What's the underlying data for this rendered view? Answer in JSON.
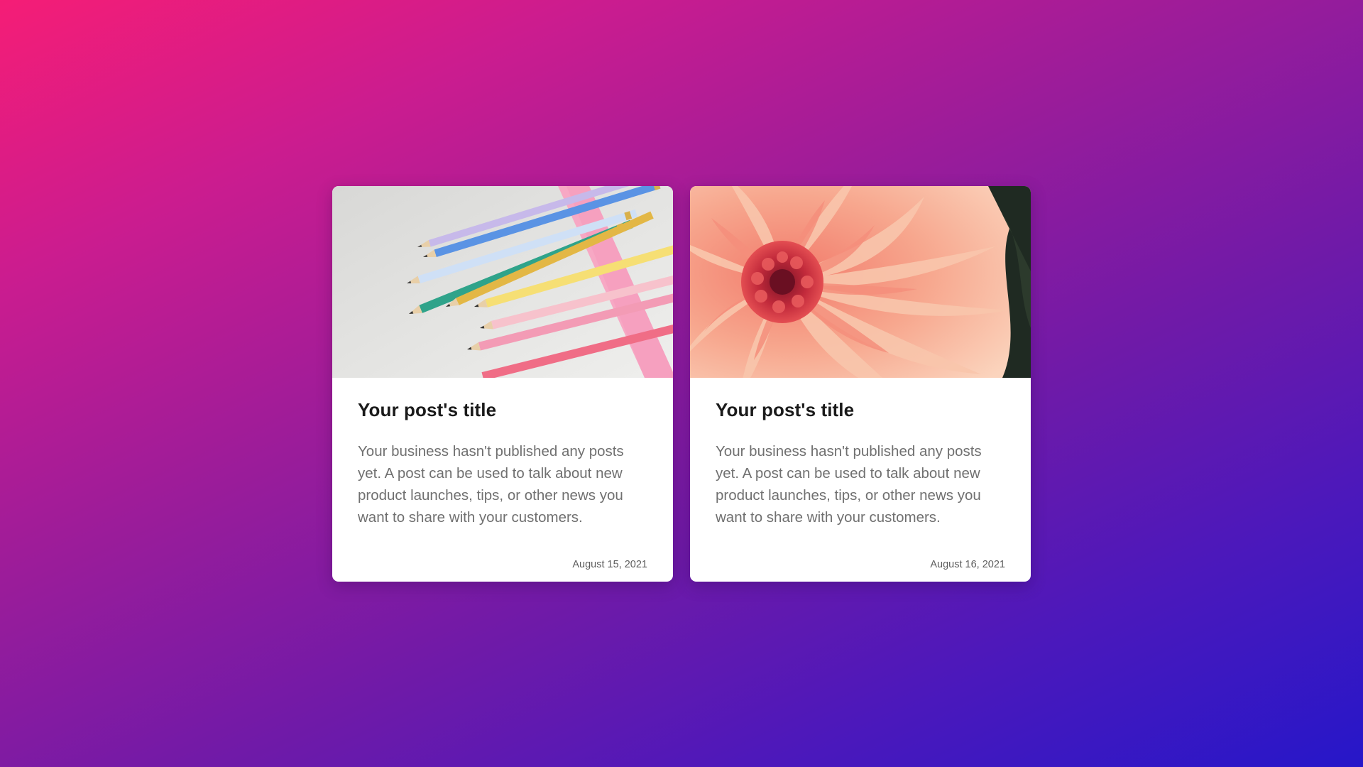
{
  "posts": [
    {
      "image": "colored-pencils-photo",
      "title": "Your post's title",
      "excerpt": "Your business hasn't published any posts yet. A post can be used to talk about new product launches, tips, or other news you want to share with your customers.",
      "date": "August 15, 2021"
    },
    {
      "image": "dahlia-flower-photo",
      "title": "Your post's title",
      "excerpt": "Your business hasn't published any posts yet. A post can be used to talk about new product launches, tips, or other news you want to share with your customers.",
      "date": "August 16, 2021"
    }
  ],
  "colors": {
    "background_start": "#f51d76",
    "background_end": "#2617c9",
    "card": "#ffffff",
    "title": "#1a1a1a",
    "body_text": "#707070",
    "date_text": "#5c5c5c"
  }
}
